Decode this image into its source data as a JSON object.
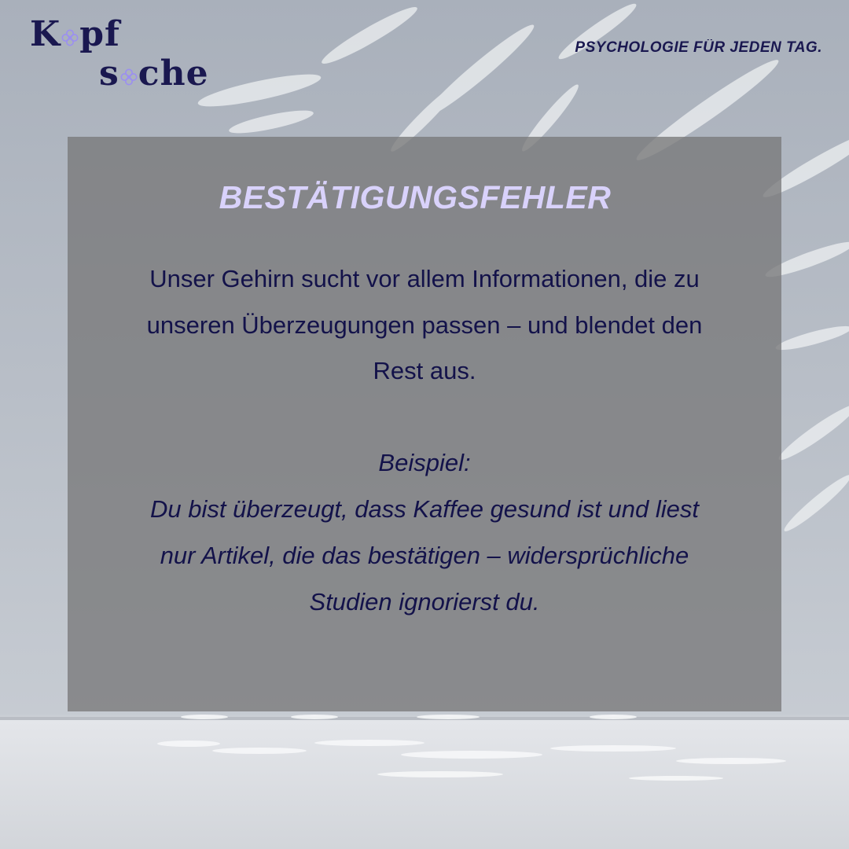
{
  "logo": {
    "line1_a": "K",
    "line1_b": "pf",
    "line2_a": "s",
    "line2_b": "che",
    "flower_icon": "flower-icon",
    "flower_color": "#9b8ff0"
  },
  "tagline": "PSYCHOLOGIE FÜR JEDEN TAG.",
  "card": {
    "title": "BESTÄTIGUNGSFEHLER",
    "body": [
      "Unser Gehirn sucht vor allem Informationen, die zu",
      "unseren Überzeugungen passen – und blendet den",
      "Rest aus."
    ],
    "example_label": "Beispiel:",
    "example_lines": [
      "Du bist überzeugt, dass Kaffee gesund ist und liest",
      "nur Artikel, die das bestätigen – widersprüchliche",
      "Studien ignorierst du."
    ]
  },
  "colors": {
    "navy": "#1a1850",
    "title_lavender": "#d9d2fb",
    "card_gray": "#78787a"
  }
}
